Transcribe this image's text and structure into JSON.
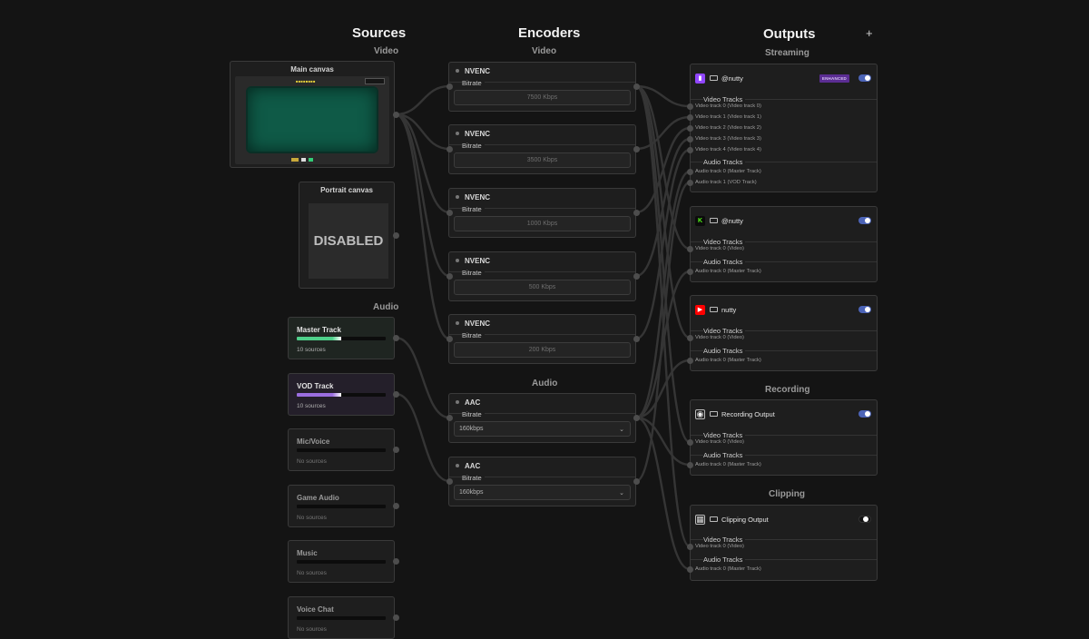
{
  "columns": {
    "sources": "Sources",
    "encoders": "Encoders",
    "outputs": "Outputs",
    "add_output_label": "+"
  },
  "sources": {
    "video_label": "Video",
    "audio_label": "Audio",
    "main_canvas": {
      "title": "Main canvas"
    },
    "portrait_canvas": {
      "title": "Portrait canvas",
      "status": "DISABLED"
    },
    "audio_tracks": [
      {
        "name": "Master Track",
        "count": "10 sources",
        "level": 0.5,
        "color": "#4fd08a"
      },
      {
        "name": "VOD Track",
        "count": "10 sources",
        "level": 0.5,
        "color": "#9b6ee0"
      },
      {
        "name": "Mic/Voice",
        "count": "No sources",
        "level": 0
      },
      {
        "name": "Game Audio",
        "count": "No sources",
        "level": 0
      },
      {
        "name": "Music",
        "count": "No sources",
        "level": 0
      },
      {
        "name": "Voice Chat",
        "count": "No sources",
        "level": 0
      }
    ]
  },
  "encoders": {
    "video_label": "Video",
    "audio_label": "Audio",
    "bitrate_label": "Bitrate",
    "video": [
      {
        "name": "NVENC",
        "bitrate": "7500 Kbps"
      },
      {
        "name": "NVENC",
        "bitrate": "3500 Kbps"
      },
      {
        "name": "NVENC",
        "bitrate": "1000 Kbps"
      },
      {
        "name": "NVENC",
        "bitrate": "500 Kbps"
      },
      {
        "name": "NVENC",
        "bitrate": "200 Kbps"
      }
    ],
    "audio": [
      {
        "name": "AAC",
        "bitrate": "160kbps"
      },
      {
        "name": "AAC",
        "bitrate": "160kbps"
      }
    ]
  },
  "outputs": {
    "streaming_label": "Streaming",
    "recording_label": "Recording",
    "clipping_label": "Clipping",
    "video_tracks_label": "Video Tracks",
    "audio_tracks_label": "Audio Tracks",
    "cards": [
      {
        "platform": "twitch",
        "name": "@nutty",
        "badge": "ENHANCED",
        "enabled": true,
        "video_tracks": [
          "Video track 0 (Video track 0)",
          "Video track 1 (Video track 1)",
          "Video track 2 (Video track 2)",
          "Video track 3 (Video track 3)",
          "Video track 4 (Video track 4)"
        ],
        "audio_tracks": [
          "Audio track 0 (Master Track)",
          "Audio track 1 (VOD Track)"
        ]
      },
      {
        "platform": "kick",
        "name": "@nutty",
        "enabled": true,
        "video_tracks": [
          "Video track 0 (Video)"
        ],
        "audio_tracks": [
          "Audio track 0 (Master Track)"
        ]
      },
      {
        "platform": "youtube",
        "name": "nutty",
        "enabled": true,
        "video_tracks": [
          "Video track 0 (Video)"
        ],
        "audio_tracks": [
          "Audio track 0 (Master Track)"
        ]
      },
      {
        "platform": "recording",
        "name": "Recording Output",
        "enabled": true,
        "video_tracks": [
          "Video track 0 (Video)"
        ],
        "audio_tracks": [
          "Audio track 0 (Master Track)"
        ]
      },
      {
        "platform": "clipping",
        "name": "Clipping Output",
        "enabled": false,
        "video_tracks": [
          "Video track 0 (Video)"
        ],
        "audio_tracks": [
          "Audio track 0 (Master Track)"
        ]
      }
    ]
  },
  "colors": {
    "background": "#141414",
    "card": "#1e1e1e",
    "toggle_on": "#4c64b7",
    "twitch": "#9146ff",
    "kick": "#53fc18",
    "youtube": "#ff0000",
    "badge": "#5b2d93"
  }
}
